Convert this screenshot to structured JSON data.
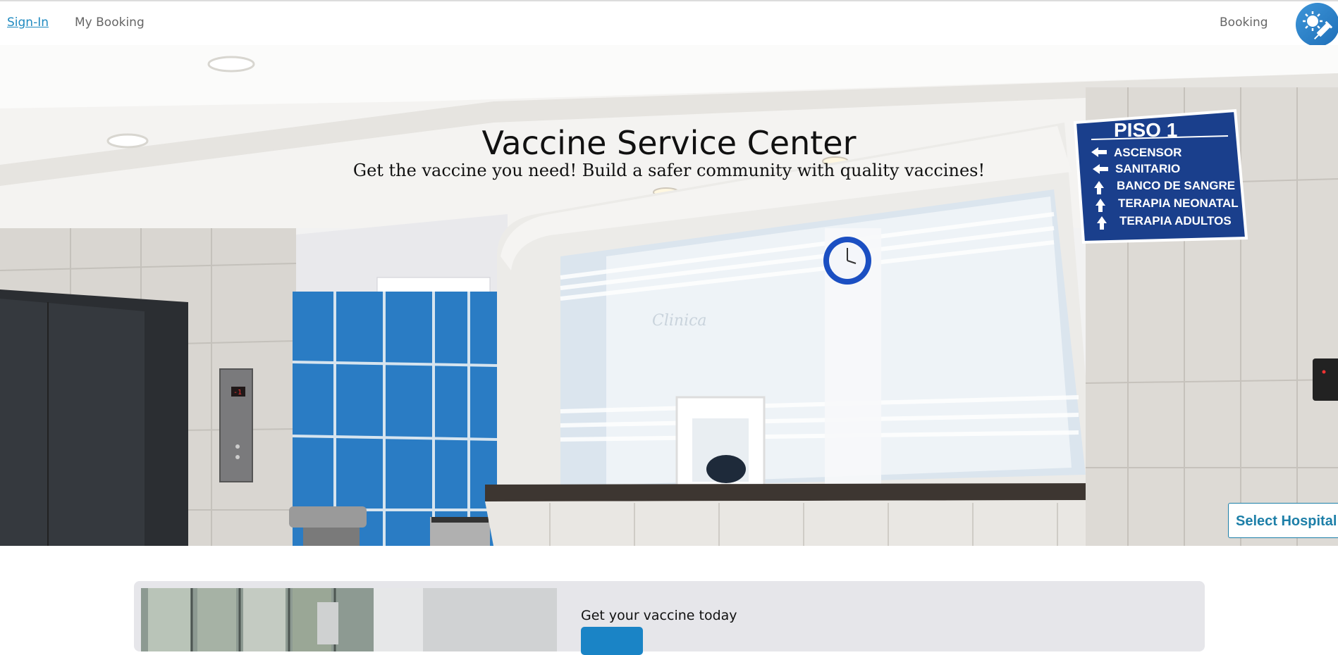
{
  "nav": {
    "signin_label": "Sign-In",
    "mybooking_label": "My Booking",
    "booking_label": "Booking",
    "logo_icon": "vaccine-syringe-icon"
  },
  "hero": {
    "title": "Vaccine Service Center",
    "subtitle": "Get the vaccine you need! Build a safer community with quality vaccines!",
    "sign": {
      "heading": "PISO 1",
      "lines": [
        "ASCENSOR",
        "SANITARIO",
        "BANCO DE SANGRE",
        "TERAPIA NEONATAL",
        "TERAPIA ADULTOS"
      ]
    },
    "elevator_display": "-1",
    "window_text": "Clinica"
  },
  "select_hospital_label": "Select Hospital",
  "card": {
    "title": "Get your vaccine today",
    "button_label": ""
  },
  "colors": {
    "accent": "#1f8ac0",
    "button": "#1a84c6",
    "tile_blue": "#2a7cc4",
    "sign_blue": "#1a3f8c"
  }
}
